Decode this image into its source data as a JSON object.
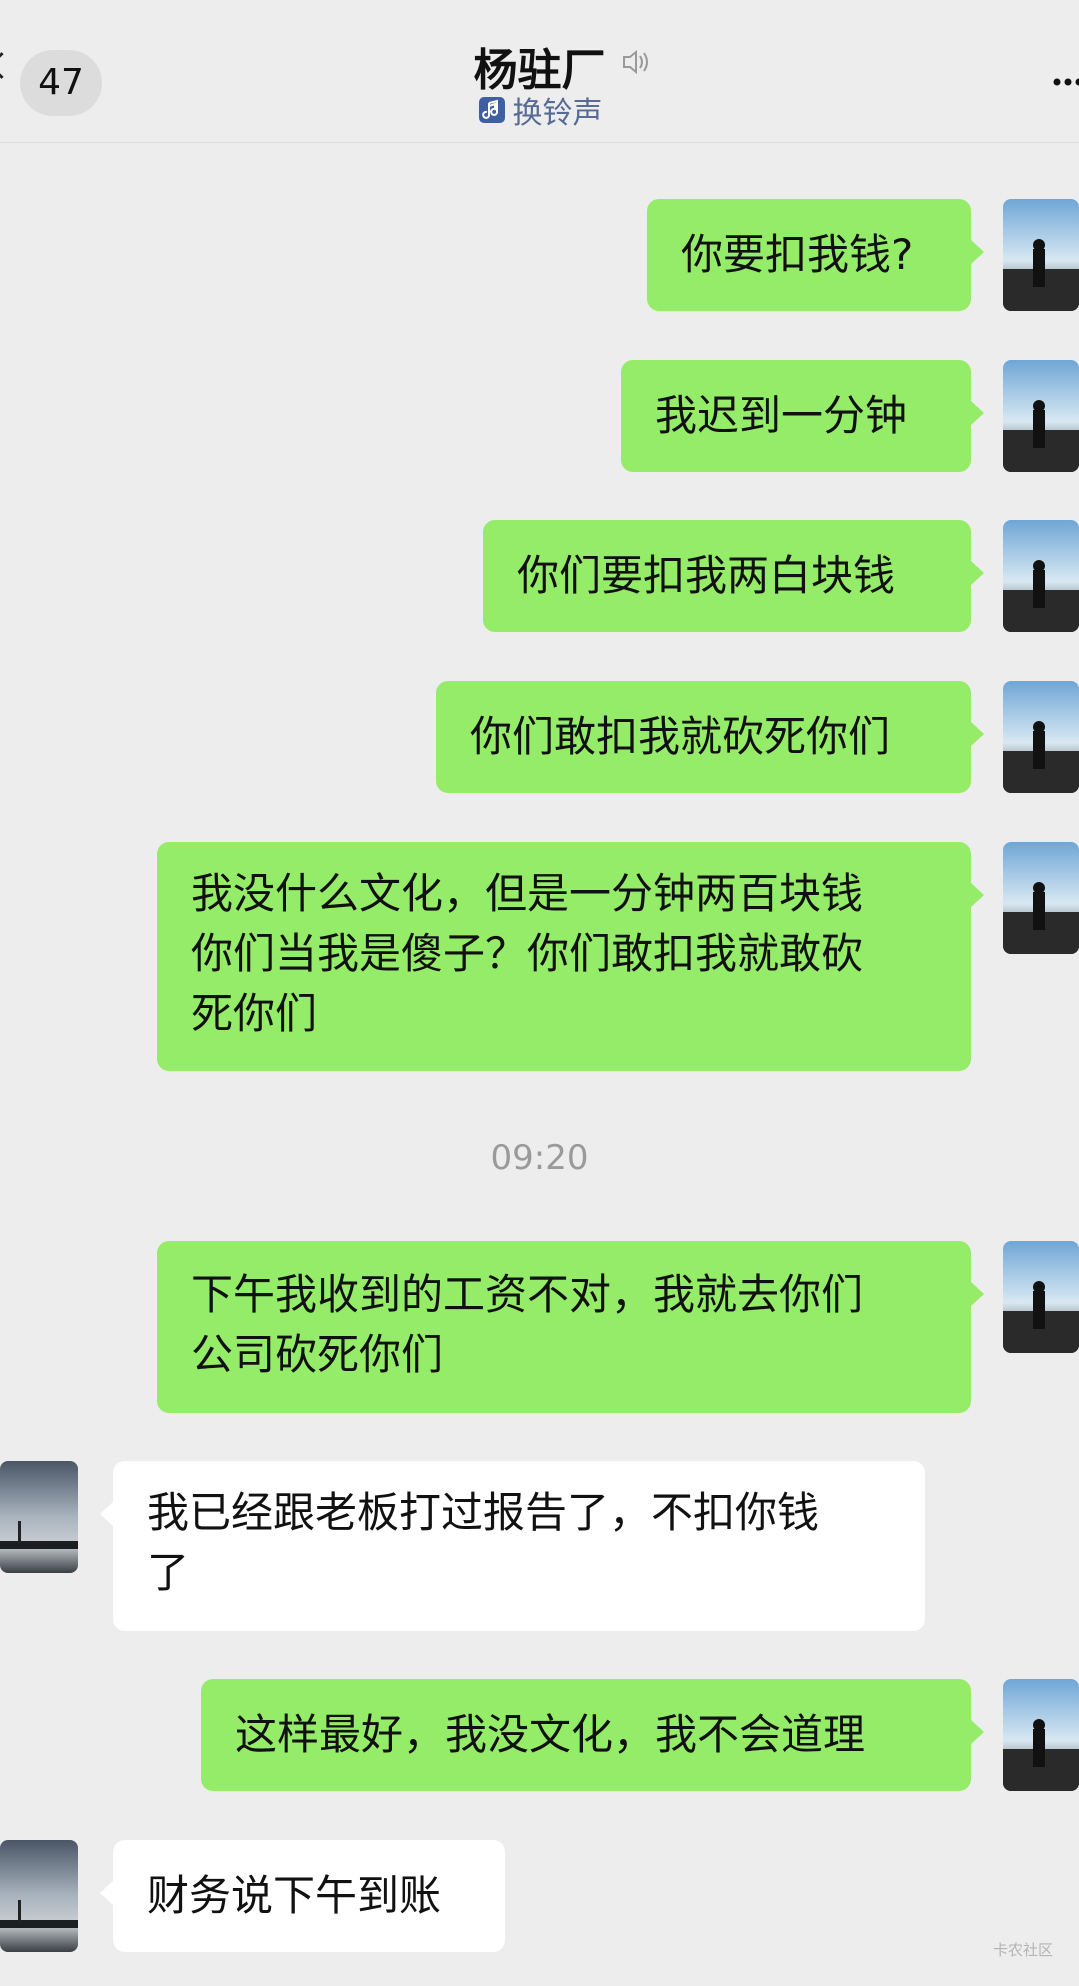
{
  "header": {
    "back_icon": "chevron-left-icon",
    "unread_count": "47",
    "title": "杨驻厂",
    "mute_icon": "speaker-muted-icon",
    "subtitle": "换铃声",
    "subtitle_icon": "music-note-icon",
    "more_icon": "more-dots-icon"
  },
  "messages": [
    {
      "from": "me",
      "text": "你要扣我钱?"
    },
    {
      "from": "me",
      "text": "我迟到一分钟"
    },
    {
      "from": "me",
      "text": "你们要扣我两白块钱"
    },
    {
      "from": "me",
      "text": "你们敢扣我就砍死你们"
    },
    {
      "from": "me",
      "text": "我没什么文化，但是一分钟两百块钱\n你们当我是傻子？你们敢扣我就敢砍\n死你们"
    },
    {
      "from": "me",
      "text": "下午我收到的工资不对，我就去你们\n公司砍死你们"
    },
    {
      "from": "other",
      "text": "我已经跟老板打过报告了，不扣你钱\n了"
    },
    {
      "from": "me",
      "text": "这样最好，我没文化，我不会道理"
    },
    {
      "from": "other",
      "text": "财务说下午到账"
    }
  ],
  "time_divider": "09:20",
  "watermark": "卡农社区",
  "colors": {
    "background": "#ededed",
    "my_bubble": "#95ec69",
    "other_bubble": "#ffffff",
    "link": "#576b95"
  }
}
